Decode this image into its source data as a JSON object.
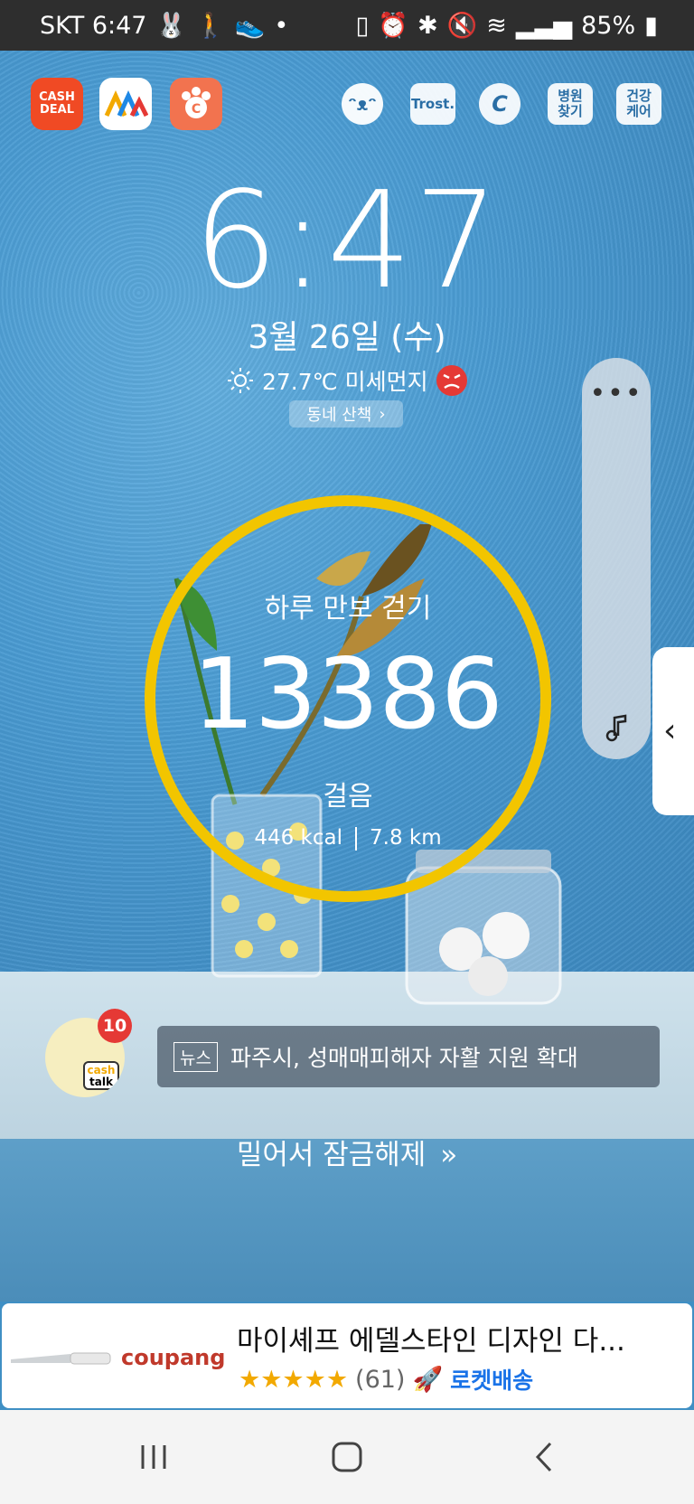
{
  "status_bar": {
    "carrier_time": "SKT 6:47",
    "battery": "85%"
  },
  "top_apps": {
    "cashdeal_label": "CASH DEAL",
    "trost_label": "Trost.",
    "hospital_label_1": "병원",
    "hospital_label_2": "찾기",
    "health_label_1": "건강",
    "health_label_2": "케어"
  },
  "lockscreen": {
    "clock": "6:47",
    "date": "3월 26일 (수)",
    "weather": "27.7℃ 미세먼지",
    "walk_button": "동네 산책"
  },
  "steps": {
    "title": "하루 만보 걷기",
    "count": "13386",
    "unit": "걸음",
    "kcal": "446 kcal",
    "distance": "7.8 km",
    "accent_color": "#f2c500"
  },
  "cashtalk": {
    "badge": "10",
    "label_1": "cash",
    "label_2": "talk"
  },
  "news": {
    "tag": "뉴스",
    "headline": "파주시, 성매매피해자 자활 지원 확대"
  },
  "unlock_hint": "밀어서 잠금해제",
  "ad": {
    "brand": "coupang",
    "title": "마이셰프 에델스타인 디자인 다...",
    "stars": "★★★★★",
    "review_count": "(61)",
    "delivery": "로켓배송"
  }
}
